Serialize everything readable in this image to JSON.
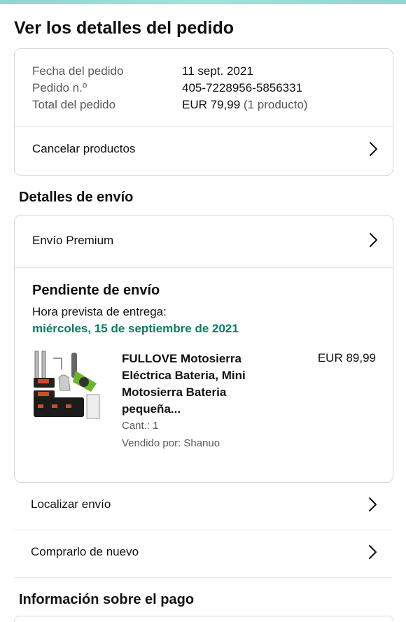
{
  "page_title": "Ver los detalles del pedido",
  "order": {
    "date_label": "Fecha del pedido",
    "date_value": "11 sept. 2021",
    "number_label": "Pedido n.º",
    "number_value": "405-7228956-5856331",
    "total_label": "Total del pedido",
    "total_value": "EUR 79,99",
    "total_note": "(1 producto)",
    "cancel_label": "Cancelar productos"
  },
  "shipping": {
    "section_title": "Detalles de envío",
    "method_label": "Envío Premium",
    "status_title": "Pendiente de envío",
    "eta_label": "Hora prevista de entrega:",
    "eta_date": "miércoles, 15 de septiembre de 2021",
    "eta_color": "#067d62"
  },
  "product": {
    "name": "FULLOVE Motosierra Eléctrica Bateria, Mini Motosierra Bateria pequeña...",
    "price": "EUR 89,99",
    "quantity": "Cant.: 1",
    "seller": "Vendido por: Shanuo",
    "image_icon": "chainsaw-product-image"
  },
  "actions": {
    "track_label": "Localizar envío",
    "buy_again_label": "Comprarlo de nuevo"
  },
  "payment": {
    "section_title": "Información sobre el pago"
  }
}
